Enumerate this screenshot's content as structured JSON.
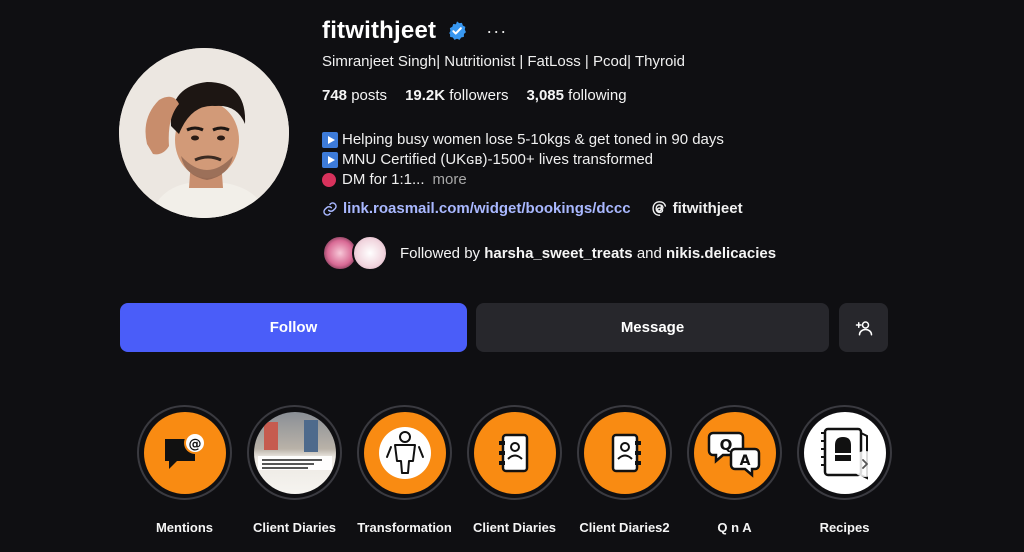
{
  "profile": {
    "username": "fitwithjeet",
    "full_name": "Simranjeet Singh| Nutritionist | FatLoss | Pcod| Thyroid",
    "more_options": "···"
  },
  "stats": {
    "posts_count": "748",
    "posts_label": "posts",
    "followers_count": "19.2K",
    "followers_label": "followers",
    "following_count": "3,085",
    "following_label": "following"
  },
  "bio": {
    "line1": "Helping busy women lose 5-10kgs & get toned in 90 days",
    "line2": "MNU Certified (UKɢʙ)-1500+ lives transformed",
    "line3": "DM for 1:1...",
    "more_label": "more"
  },
  "links": {
    "website": "link.roasmail.com/widget/bookings/dccc",
    "threads_handle": "fitwithjeet"
  },
  "followed_by": {
    "prefix": "Followed by",
    "user1": "harsha_sweet_treats",
    "conjunction": "and",
    "user2": "nikis.delicacies"
  },
  "actions": {
    "follow_label": "Follow",
    "message_label": "Message"
  },
  "highlights": [
    {
      "label": "Mentions",
      "icon": "mention-chat-icon"
    },
    {
      "label": "Client Diaries",
      "icon": "photo-thumbnail"
    },
    {
      "label": "Transformation",
      "icon": "body-transformation-icon"
    },
    {
      "label": "Client Diaries",
      "icon": "diary-contact-icon"
    },
    {
      "label": "Client Diaries2",
      "icon": "diary-contact-icon"
    },
    {
      "label": "Q n A",
      "icon": "qa-bubbles-icon"
    },
    {
      "label": "Recipes",
      "icon": "recipe-book-icon"
    }
  ],
  "colors": {
    "background": "#0f0f12",
    "follow_button": "#4a5df9",
    "secondary_button": "#27272c",
    "highlight_orange": "#f98b12",
    "link": "#a9b8ff",
    "verified_badge": "#3897f0"
  }
}
